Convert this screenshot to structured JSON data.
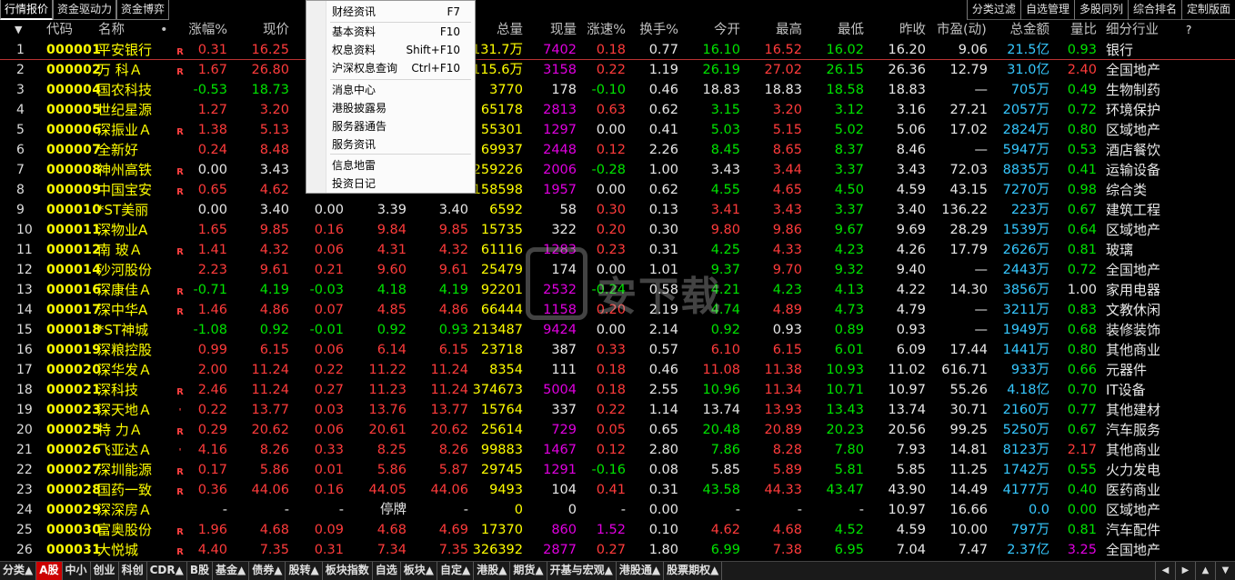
{
  "top_tabs": [
    {
      "label": "行情报价",
      "active": true
    },
    {
      "label": "资金驱动力",
      "active": false
    },
    {
      "label": "资金博弈",
      "active": false
    }
  ],
  "right_tools": [
    "分类过滤",
    "自选管理",
    "多股同列",
    "综合排名",
    "定制版面"
  ],
  "columns": {
    "sort_arrow": "▼",
    "code": "代码",
    "name": "名称",
    "dot": "•",
    "change_pct": "涨幅%",
    "price": "现价",
    "volume": "总量",
    "cur_volume": "现量",
    "speed": "涨速%",
    "turnover": "换手%",
    "open": "今开",
    "high": "最高",
    "low": "最低",
    "prev_close": "昨收",
    "pe": "市盈(动)",
    "amount": "总金额",
    "vol_ratio": "量比",
    "industry": "细分行业",
    "help": "?"
  },
  "context_menu": {
    "items": [
      {
        "label": "财经资讯",
        "shortcut": "F7"
      },
      {
        "label": "基本资料",
        "shortcut": "F10"
      },
      {
        "label": "权息资料",
        "shortcut": "Shift+F10"
      },
      {
        "label": "沪深权息查询",
        "shortcut": "Ctrl+F10"
      },
      {
        "label": "消息中心",
        "shortcut": ""
      },
      {
        "label": "港股披露易",
        "shortcut": ""
      },
      {
        "label": "服务器通告",
        "shortcut": ""
      },
      {
        "label": "服务资讯",
        "shortcut": ""
      },
      {
        "label": "信息地雷",
        "shortcut": ""
      },
      {
        "label": "投资日记",
        "shortcut": ""
      }
    ]
  },
  "watermark": {
    "text": "安下载"
  },
  "rows": [
    {
      "idx": "1",
      "code": "000001",
      "name": "平安银行",
      "mark": "R",
      "chg": "0.31",
      "price": "16.25",
      "c_change": "",
      "c_bid": "",
      "c_ask": "",
      "vol": "131.7万",
      "curvol": "7402",
      "speed": "0.18",
      "turnover": "0.77",
      "open": "16.10",
      "high": "16.52",
      "low": "16.02",
      "prevclose": "16.20",
      "pe": "9.06",
      "amount": "21.5亿",
      "volratio": "0.93",
      "industry": "银行",
      "dir": "up",
      "open_c": "dn",
      "high_c": "up",
      "low_c": "dn",
      "curvol_c": "mg",
      "speed_c": "up",
      "vr_c": "dn"
    },
    {
      "idx": "2",
      "code": "000002",
      "name": "万 科Ａ",
      "mark": "R",
      "chg": "1.67",
      "price": "26.80",
      "c_change": "",
      "c_bid": "",
      "c_ask": "",
      "vol": "115.6万",
      "curvol": "3158",
      "speed": "0.22",
      "turnover": "1.19",
      "open": "26.19",
      "high": "27.02",
      "low": "26.15",
      "prevclose": "26.36",
      "pe": "12.79",
      "amount": "31.0亿",
      "volratio": "2.40",
      "industry": "全国地产",
      "dir": "up",
      "open_c": "dn",
      "high_c": "up",
      "low_c": "dn",
      "curvol_c": "mg",
      "speed_c": "up",
      "vr_c": "up"
    },
    {
      "idx": "3",
      "code": "000004",
      "name": "国农科技",
      "mark": "",
      "chg": "-0.53",
      "price": "18.73",
      "c_change": "",
      "c_bid": "",
      "c_ask": "",
      "vol": "3770",
      "curvol": "178",
      "speed": "-0.10",
      "turnover": "0.46",
      "open": "18.83",
      "high": "18.83",
      "low": "18.58",
      "prevclose": "18.83",
      "pe": "—",
      "amount": "705万",
      "volratio": "0.49",
      "industry": "生物制药",
      "dir": "dn",
      "open_c": "wt",
      "high_c": "wt",
      "low_c": "dn",
      "curvol_c": "wt",
      "speed_c": "dn",
      "vr_c": "dn"
    },
    {
      "idx": "4",
      "code": "000005",
      "name": "世纪星源",
      "mark": "",
      "chg": "1.27",
      "price": "3.20",
      "c_change": "",
      "c_bid": "",
      "c_ask": "",
      "vol": "65178",
      "curvol": "2813",
      "speed": "0.63",
      "turnover": "0.62",
      "open": "3.15",
      "high": "3.20",
      "low": "3.12",
      "prevclose": "3.16",
      "pe": "27.21",
      "amount": "2057万",
      "volratio": "0.72",
      "industry": "环境保护",
      "dir": "up",
      "open_c": "dn",
      "high_c": "up",
      "low_c": "dn",
      "curvol_c": "mg",
      "speed_c": "up",
      "vr_c": "dn"
    },
    {
      "idx": "5",
      "code": "000006",
      "name": "深振业Ａ",
      "mark": "R",
      "chg": "1.38",
      "price": "5.13",
      "c_change": "",
      "c_bid": "",
      "c_ask": "",
      "vol": "55301",
      "curvol": "1297",
      "speed": "0.00",
      "turnover": "0.41",
      "open": "5.03",
      "high": "5.15",
      "low": "5.02",
      "prevclose": "5.06",
      "pe": "17.02",
      "amount": "2824万",
      "volratio": "0.80",
      "industry": "区域地产",
      "dir": "up",
      "open_c": "dn",
      "high_c": "up",
      "low_c": "dn",
      "curvol_c": "mg",
      "speed_c": "wt",
      "vr_c": "dn"
    },
    {
      "idx": "6",
      "code": "000007",
      "name": "全新好",
      "mark": "",
      "chg": "0.24",
      "price": "8.48",
      "c_change": "",
      "c_bid": "",
      "c_ask": "",
      "vol": "69937",
      "curvol": "2448",
      "speed": "0.12",
      "turnover": "2.26",
      "open": "8.45",
      "high": "8.65",
      "low": "8.37",
      "prevclose": "8.46",
      "pe": "—",
      "amount": "5947万",
      "volratio": "0.53",
      "industry": "酒店餐饮",
      "dir": "up",
      "open_c": "dn",
      "high_c": "up",
      "low_c": "dn",
      "curvol_c": "mg",
      "speed_c": "up",
      "vr_c": "dn"
    },
    {
      "idx": "7",
      "code": "000008",
      "name": "神州高铁",
      "mark": "R",
      "chg": "0.00",
      "price": "3.43",
      "c_change": "",
      "c_bid": "",
      "c_ask": "",
      "vol": "259226",
      "curvol": "2006",
      "speed": "-0.28",
      "turnover": "1.00",
      "open": "3.43",
      "high": "3.44",
      "low": "3.37",
      "prevclose": "3.43",
      "pe": "72.03",
      "amount": "8835万",
      "volratio": "0.41",
      "industry": "运输设备",
      "dir": "eq",
      "open_c": "wt",
      "high_c": "up",
      "low_c": "dn",
      "curvol_c": "mg",
      "speed_c": "dn",
      "vr_c": "dn"
    },
    {
      "idx": "8",
      "code": "000009",
      "name": "中国宝安",
      "mark": "R",
      "chg": "0.65",
      "price": "4.62",
      "c_change": "",
      "c_bid": "",
      "c_ask": "",
      "vol": "158598",
      "curvol": "1957",
      "speed": "0.00",
      "turnover": "0.62",
      "open": "4.55",
      "high": "4.65",
      "low": "4.50",
      "prevclose": "4.59",
      "pe": "43.15",
      "amount": "7270万",
      "volratio": "0.98",
      "industry": "综合类",
      "dir": "up",
      "open_c": "dn",
      "high_c": "up",
      "low_c": "dn",
      "curvol_c": "mg",
      "speed_c": "wt",
      "vr_c": "dn"
    },
    {
      "idx": "9",
      "code": "000010",
      "name": "*ST美丽",
      "mark": "",
      "chg": "0.00",
      "price": "3.40",
      "c_change": "0.00",
      "c_bid": "3.39",
      "c_ask": "3.40",
      "vol": "6592",
      "curvol": "58",
      "speed": "0.30",
      "turnover": "0.13",
      "open": "3.41",
      "high": "3.43",
      "low": "3.37",
      "prevclose": "3.40",
      "pe": "136.22",
      "amount": "223万",
      "volratio": "0.67",
      "industry": "建筑工程",
      "dir": "eq",
      "open_c": "up",
      "high_c": "up",
      "low_c": "dn",
      "curvol_c": "wt",
      "speed_c": "up",
      "vr_c": "dn"
    },
    {
      "idx": "10",
      "code": "000011",
      "name": "深物业A",
      "mark": "",
      "chg": "1.65",
      "price": "9.85",
      "c_change": "0.16",
      "c_bid": "9.84",
      "c_ask": "9.85",
      "vol": "15735",
      "curvol": "322",
      "speed": "0.20",
      "turnover": "0.30",
      "open": "9.80",
      "high": "9.86",
      "low": "9.67",
      "prevclose": "9.69",
      "pe": "28.29",
      "amount": "1539万",
      "volratio": "0.64",
      "industry": "区域地产",
      "dir": "up",
      "open_c": "up",
      "high_c": "up",
      "low_c": "dn",
      "curvol_c": "wt",
      "speed_c": "up",
      "vr_c": "dn"
    },
    {
      "idx": "11",
      "code": "000012",
      "name": "南 玻Ａ",
      "mark": "R",
      "chg": "1.41",
      "price": "4.32",
      "c_change": "0.06",
      "c_bid": "4.31",
      "c_ask": "4.32",
      "vol": "61116",
      "curvol": "1283",
      "speed": "0.23",
      "turnover": "0.31",
      "open": "4.25",
      "high": "4.33",
      "low": "4.23",
      "prevclose": "4.26",
      "pe": "17.79",
      "amount": "2626万",
      "volratio": "0.81",
      "industry": "玻璃",
      "dir": "up",
      "open_c": "dn",
      "high_c": "up",
      "low_c": "dn",
      "curvol_c": "mg",
      "speed_c": "up",
      "vr_c": "dn"
    },
    {
      "idx": "12",
      "code": "000014",
      "name": "沙河股份",
      "mark": "",
      "chg": "2.23",
      "price": "9.61",
      "c_change": "0.21",
      "c_bid": "9.60",
      "c_ask": "9.61",
      "vol": "25479",
      "curvol": "174",
      "speed": "0.00",
      "turnover": "1.01",
      "open": "9.37",
      "high": "9.70",
      "low": "9.32",
      "prevclose": "9.40",
      "pe": "—",
      "amount": "2443万",
      "volratio": "0.72",
      "industry": "全国地产",
      "dir": "up",
      "open_c": "dn",
      "high_c": "up",
      "low_c": "dn",
      "curvol_c": "wt",
      "speed_c": "wt",
      "vr_c": "dn"
    },
    {
      "idx": "13",
      "code": "000016",
      "name": "深康佳Ａ",
      "mark": "R",
      "chg": "-0.71",
      "price": "4.19",
      "c_change": "-0.03",
      "c_bid": "4.18",
      "c_ask": "4.19",
      "vol": "92201",
      "curvol": "2532",
      "speed": "-0.24",
      "turnover": "0.58",
      "open": "4.21",
      "high": "4.23",
      "low": "4.13",
      "prevclose": "4.22",
      "pe": "14.30",
      "amount": "3856万",
      "volratio": "1.00",
      "industry": "家用电器",
      "dir": "dn",
      "open_c": "dn",
      "high_c": "dn",
      "low_c": "dn",
      "curvol_c": "mg",
      "speed_c": "dn",
      "vr_c": "wt"
    },
    {
      "idx": "14",
      "code": "000017",
      "name": "深中华A",
      "mark": "R",
      "chg": "1.46",
      "price": "4.86",
      "c_change": "0.07",
      "c_bid": "4.85",
      "c_ask": "4.86",
      "vol": "66444",
      "curvol": "1158",
      "speed": "0.20",
      "turnover": "2.19",
      "open": "4.74",
      "high": "4.89",
      "low": "4.73",
      "prevclose": "4.79",
      "pe": "—",
      "amount": "3211万",
      "volratio": "0.83",
      "industry": "文教休闲",
      "dir": "up",
      "open_c": "dn",
      "high_c": "up",
      "low_c": "dn",
      "curvol_c": "mg",
      "speed_c": "up",
      "vr_c": "dn"
    },
    {
      "idx": "15",
      "code": "000018",
      "name": "*ST神城",
      "mark": "",
      "chg": "-1.08",
      "price": "0.92",
      "c_change": "-0.01",
      "c_bid": "0.92",
      "c_ask": "0.93",
      "vol": "213487",
      "curvol": "9424",
      "speed": "0.00",
      "turnover": "2.14",
      "open": "0.92",
      "high": "0.93",
      "low": "0.89",
      "prevclose": "0.93",
      "pe": "—",
      "amount": "1949万",
      "volratio": "0.68",
      "industry": "装修装饰",
      "dir": "dn",
      "open_c": "dn",
      "high_c": "wt",
      "low_c": "dn",
      "curvol_c": "mg",
      "speed_c": "wt",
      "vr_c": "dn"
    },
    {
      "idx": "16",
      "code": "000019",
      "name": "深粮控股",
      "mark": "",
      "chg": "0.99",
      "price": "6.15",
      "c_change": "0.06",
      "c_bid": "6.14",
      "c_ask": "6.15",
      "vol": "23718",
      "curvol": "387",
      "speed": "0.33",
      "turnover": "0.57",
      "open": "6.10",
      "high": "6.15",
      "low": "6.01",
      "prevclose": "6.09",
      "pe": "17.44",
      "amount": "1441万",
      "volratio": "0.80",
      "industry": "其他商业",
      "dir": "up",
      "open_c": "up",
      "high_c": "up",
      "low_c": "dn",
      "curvol_c": "wt",
      "speed_c": "up",
      "vr_c": "dn"
    },
    {
      "idx": "17",
      "code": "000020",
      "name": "深华发Ａ",
      "mark": "",
      "chg": "2.00",
      "price": "11.24",
      "c_change": "0.22",
      "c_bid": "11.22",
      "c_ask": "11.24",
      "vol": "8354",
      "curvol": "111",
      "speed": "0.18",
      "turnover": "0.46",
      "open": "11.08",
      "high": "11.38",
      "low": "10.93",
      "prevclose": "11.02",
      "pe": "616.71",
      "amount": "933万",
      "volratio": "0.66",
      "industry": "元器件",
      "dir": "up",
      "open_c": "up",
      "high_c": "up",
      "low_c": "dn",
      "curvol_c": "wt",
      "speed_c": "up",
      "vr_c": "dn"
    },
    {
      "idx": "18",
      "code": "000021",
      "name": "深科技",
      "mark": "R",
      "chg": "2.46",
      "price": "11.24",
      "c_change": "0.27",
      "c_bid": "11.23",
      "c_ask": "11.24",
      "vol": "374673",
      "curvol": "5004",
      "speed": "0.18",
      "turnover": "2.55",
      "open": "10.96",
      "high": "11.34",
      "low": "10.71",
      "prevclose": "10.97",
      "pe": "55.26",
      "amount": "4.18亿",
      "volratio": "0.70",
      "industry": "IT设备",
      "dir": "up",
      "open_c": "dn",
      "high_c": "up",
      "low_c": "dn",
      "curvol_c": "mg",
      "speed_c": "up",
      "vr_c": "dn"
    },
    {
      "idx": "19",
      "code": "000023",
      "name": "深天地Ａ",
      "mark": "'",
      "chg": "0.22",
      "price": "13.77",
      "c_change": "0.03",
      "c_bid": "13.76",
      "c_ask": "13.77",
      "vol": "15764",
      "curvol": "337",
      "speed": "0.22",
      "turnover": "1.14",
      "open": "13.74",
      "high": "13.93",
      "low": "13.43",
      "prevclose": "13.74",
      "pe": "30.71",
      "amount": "2160万",
      "volratio": "0.77",
      "industry": "其他建材",
      "dir": "up",
      "open_c": "wt",
      "high_c": "up",
      "low_c": "dn",
      "curvol_c": "wt",
      "speed_c": "up",
      "vr_c": "dn"
    },
    {
      "idx": "20",
      "code": "000025",
      "name": "特 力Ａ",
      "mark": "R",
      "chg": "0.29",
      "price": "20.62",
      "c_change": "0.06",
      "c_bid": "20.61",
      "c_ask": "20.62",
      "vol": "25614",
      "curvol": "729",
      "speed": "0.05",
      "turnover": "0.65",
      "open": "20.48",
      "high": "20.89",
      "low": "20.23",
      "prevclose": "20.56",
      "pe": "99.25",
      "amount": "5250万",
      "volratio": "0.67",
      "industry": "汽车服务",
      "dir": "up",
      "open_c": "dn",
      "high_c": "up",
      "low_c": "dn",
      "curvol_c": "mg",
      "speed_c": "up",
      "vr_c": "dn"
    },
    {
      "idx": "21",
      "code": "000026",
      "name": "飞亚达Ａ",
      "mark": "'",
      "chg": "4.16",
      "price": "8.26",
      "c_change": "0.33",
      "c_bid": "8.25",
      "c_ask": "8.26",
      "vol": "99883",
      "curvol": "1467",
      "speed": "0.12",
      "turnover": "2.80",
      "open": "7.86",
      "high": "8.28",
      "low": "7.80",
      "prevclose": "7.93",
      "pe": "14.81",
      "amount": "8123万",
      "volratio": "2.17",
      "industry": "其他商业",
      "dir": "up",
      "open_c": "dn",
      "high_c": "up",
      "low_c": "dn",
      "curvol_c": "mg",
      "speed_c": "up",
      "vr_c": "up"
    },
    {
      "idx": "22",
      "code": "000027",
      "name": "深圳能源",
      "mark": "R",
      "chg": "0.17",
      "price": "5.86",
      "c_change": "0.01",
      "c_bid": "5.86",
      "c_ask": "5.87",
      "vol": "29745",
      "curvol": "1291",
      "speed": "-0.16",
      "turnover": "0.08",
      "open": "5.85",
      "high": "5.89",
      "low": "5.81",
      "prevclose": "5.85",
      "pe": "11.25",
      "amount": "1742万",
      "volratio": "0.55",
      "industry": "火力发电",
      "dir": "up",
      "open_c": "wt",
      "high_c": "up",
      "low_c": "dn",
      "curvol_c": "mg",
      "speed_c": "dn",
      "vr_c": "dn"
    },
    {
      "idx": "23",
      "code": "000028",
      "name": "国药一致",
      "mark": "R",
      "chg": "0.36",
      "price": "44.06",
      "c_change": "0.16",
      "c_bid": "44.05",
      "c_ask": "44.06",
      "vol": "9493",
      "curvol": "104",
      "speed": "0.41",
      "turnover": "0.31",
      "open": "43.58",
      "high": "44.33",
      "low": "43.47",
      "prevclose": "43.90",
      "pe": "14.49",
      "amount": "4177万",
      "volratio": "0.40",
      "industry": "医药商业",
      "dir": "up",
      "open_c": "dn",
      "high_c": "up",
      "low_c": "dn",
      "curvol_c": "wt",
      "speed_c": "up",
      "vr_c": "dn"
    },
    {
      "idx": "24",
      "code": "000029",
      "name": "深深房Ａ",
      "mark": "",
      "chg": "-",
      "price": "-",
      "c_change": "-",
      "c_bid": "停牌",
      "c_ask": "-",
      "vol": "0",
      "curvol": "0",
      "speed": "-",
      "turnover": "0.00",
      "open": "-",
      "high": "-",
      "low": "-",
      "prevclose": "10.97",
      "pe": "16.66",
      "amount": "0.0",
      "volratio": "0.00",
      "industry": "区域地产",
      "dir": "eq",
      "open_c": "wt",
      "high_c": "wt",
      "low_c": "wt",
      "curvol_c": "wt",
      "speed_c": "wt",
      "vr_c": "dn"
    },
    {
      "idx": "25",
      "code": "000030",
      "name": "富奥股份",
      "mark": "R",
      "chg": "1.96",
      "price": "4.68",
      "c_change": "0.09",
      "c_bid": "4.68",
      "c_ask": "4.69",
      "vol": "17370",
      "curvol": "860",
      "speed": "1.52",
      "turnover": "0.10",
      "open": "4.62",
      "high": "4.68",
      "low": "4.52",
      "prevclose": "4.59",
      "pe": "10.00",
      "amount": "797万",
      "volratio": "0.81",
      "industry": "汽车配件",
      "dir": "up",
      "open_c": "up",
      "high_c": "up",
      "low_c": "dn",
      "curvol_c": "mg",
      "speed_c": "mg",
      "vr_c": "dn"
    },
    {
      "idx": "26",
      "code": "000031",
      "name": "大悦城",
      "mark": "R",
      "chg": "4.40",
      "price": "7.35",
      "c_change": "0.31",
      "c_bid": "7.34",
      "c_ask": "7.35",
      "vol": "326392",
      "curvol": "2877",
      "speed": "0.27",
      "turnover": "1.80",
      "open": "6.99",
      "high": "7.38",
      "low": "6.95",
      "prevclose": "7.04",
      "pe": "7.47",
      "amount": "2.37亿",
      "volratio": "3.25",
      "industry": "全国地产",
      "dir": "up",
      "open_c": "dn",
      "high_c": "up",
      "low_c": "dn",
      "curvol_c": "mg",
      "speed_c": "up",
      "vr_c": "mg"
    }
  ],
  "bottom_tabs": [
    {
      "label": "分类▲",
      "active": false
    },
    {
      "label": "A股",
      "active": true
    },
    {
      "label": "中小",
      "active": false
    },
    {
      "label": "创业",
      "active": false
    },
    {
      "label": "科创",
      "active": false
    },
    {
      "label": "CDR▲",
      "active": false
    },
    {
      "label": "B股",
      "active": false
    },
    {
      "label": "基金▲",
      "active": false
    },
    {
      "label": "债券▲",
      "active": false
    },
    {
      "label": "股转▲",
      "active": false
    },
    {
      "label": "板块指数",
      "active": false
    },
    {
      "label": "自选",
      "active": false
    },
    {
      "label": "板块▲",
      "active": false
    },
    {
      "label": "自定▲",
      "active": false
    },
    {
      "label": "港股▲",
      "active": false
    },
    {
      "label": "期货▲",
      "active": false
    },
    {
      "label": "开基与宏观▲",
      "active": false
    },
    {
      "label": "港股通▲",
      "active": false
    },
    {
      "label": "股票期权▲",
      "active": false
    }
  ],
  "bottom_nav": [
    "◀",
    "▶",
    "▲",
    "▼"
  ],
  "colors": {
    "up": "#ff3b3b",
    "down": "#00e400",
    "code": "#ffff00",
    "magenta": "#e000e0",
    "cyan": "#36c8ff",
    "active_tab": "#cc0000"
  }
}
